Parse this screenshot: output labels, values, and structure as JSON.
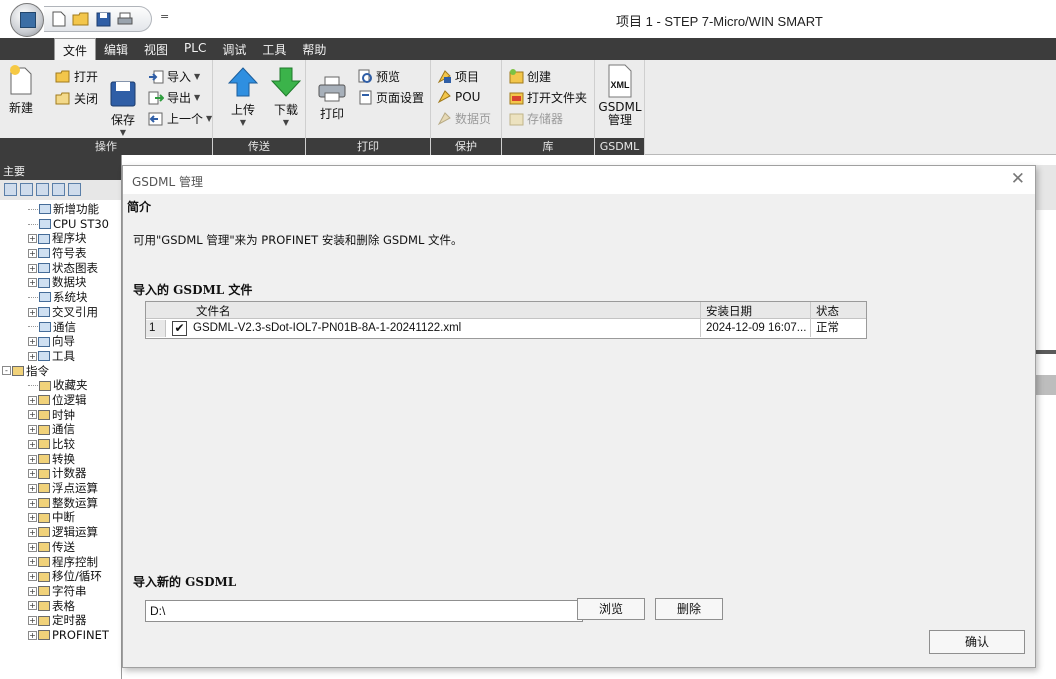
{
  "window": {
    "title": "项目 1 - STEP 7-Micro/WIN SMART",
    "qat_more": "="
  },
  "menu": [
    "文件",
    "编辑",
    "视图",
    "PLC",
    "调试",
    "工具",
    "帮助"
  ],
  "ribbon": {
    "groups": {
      "operation": "操作",
      "transfer": "传送",
      "print": "打印",
      "protect": "保护",
      "library": "库",
      "gsdml": "GSDML"
    },
    "new": "新建",
    "open": "打开",
    "close": "关闭",
    "save": "保存",
    "import": "导入",
    "export": "导出",
    "previous": "上一个",
    "upload": "上传",
    "download": "下载",
    "print": "打印",
    "preview": "预览",
    "page_setup": "页面设置",
    "project": "项目",
    "pou": "POU",
    "data_page": "数据页",
    "create": "创建",
    "open_folder": "打开文件夹",
    "storage": "存储器",
    "gsdml_label": "GSDML",
    "gsdml_manage": "管理",
    "xml_icon_text": "XML"
  },
  "left_pane": {
    "title": "主要",
    "tree": [
      {
        "label": "新增功能",
        "indent": 1,
        "expander": ""
      },
      {
        "label": "CPU ST30",
        "indent": 1,
        "expander": ""
      },
      {
        "label": "程序块",
        "indent": 1,
        "expander": "+"
      },
      {
        "label": "符号表",
        "indent": 1,
        "expander": "+"
      },
      {
        "label": "状态图表",
        "indent": 1,
        "expander": "+"
      },
      {
        "label": "数据块",
        "indent": 1,
        "expander": "+"
      },
      {
        "label": "系统块",
        "indent": 1,
        "expander": ""
      },
      {
        "label": "交叉引用",
        "indent": 1,
        "expander": "+"
      },
      {
        "label": "通信",
        "indent": 1,
        "expander": ""
      },
      {
        "label": "向导",
        "indent": 1,
        "expander": "+"
      },
      {
        "label": "工具",
        "indent": 1,
        "expander": "+"
      },
      {
        "label": "指令",
        "indent": 0,
        "expander": "-"
      },
      {
        "label": "收藏夹",
        "indent": 1,
        "expander": ""
      },
      {
        "label": "位逻辑",
        "indent": 1,
        "expander": "+"
      },
      {
        "label": "时钟",
        "indent": 1,
        "expander": "+"
      },
      {
        "label": "通信",
        "indent": 1,
        "expander": "+"
      },
      {
        "label": "比较",
        "indent": 1,
        "expander": "+"
      },
      {
        "label": "转换",
        "indent": 1,
        "expander": "+"
      },
      {
        "label": "计数器",
        "indent": 1,
        "expander": "+"
      },
      {
        "label": "浮点运算",
        "indent": 1,
        "expander": "+"
      },
      {
        "label": "整数运算",
        "indent": 1,
        "expander": "+"
      },
      {
        "label": "中断",
        "indent": 1,
        "expander": "+"
      },
      {
        "label": "逻辑运算",
        "indent": 1,
        "expander": "+"
      },
      {
        "label": "传送",
        "indent": 1,
        "expander": "+"
      },
      {
        "label": "程序控制",
        "indent": 1,
        "expander": "+"
      },
      {
        "label": "移位/循环",
        "indent": 1,
        "expander": "+"
      },
      {
        "label": "字符串",
        "indent": 1,
        "expander": "+"
      },
      {
        "label": "表格",
        "indent": 1,
        "expander": "+"
      },
      {
        "label": "定时器",
        "indent": 1,
        "expander": "+"
      },
      {
        "label": "PROFINET",
        "indent": 1,
        "expander": "+"
      }
    ]
  },
  "dialog": {
    "title": "GSDML 管理",
    "close_glyph": "✕",
    "intro_heading": "简介",
    "intro_text": "可用\"GSDML 管理\"来为 PROFINET 安装和删除 GSDML 文件。",
    "imported_heading": "导入的 GSDML 文件",
    "table": {
      "headers": {
        "filename": "文件名",
        "install_date": "安装日期",
        "status": "状态"
      },
      "rows": [
        {
          "num": "1",
          "checked": true,
          "filename": "GSDML-V2.3-sDot-IOL7-PN01B-8A-1-20241122.xml",
          "install_date": "2024-12-09 16:07...",
          "status": "正常"
        }
      ]
    },
    "import_new_heading": "导入新的 GSDML",
    "path_value": "D:\\",
    "browse": "浏览",
    "delete": "删除",
    "ok": "确认"
  }
}
